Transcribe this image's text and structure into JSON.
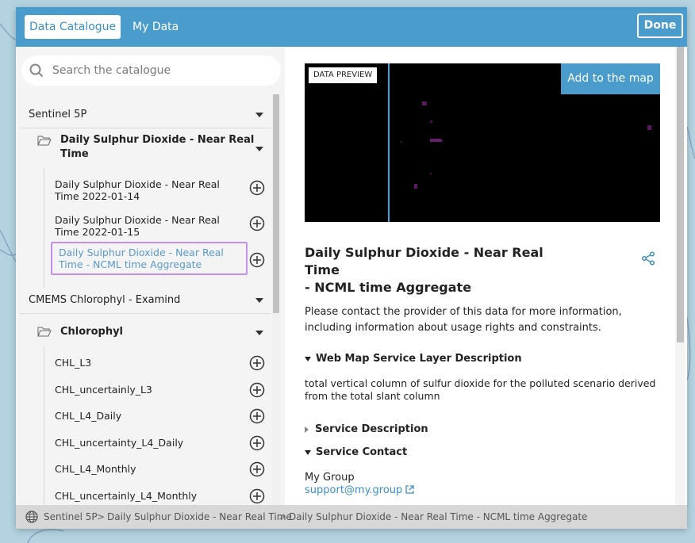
{
  "tabs": [
    {
      "label": "Data Catalogue"
    },
    {
      "label": "My Data"
    }
  ],
  "done_label": "Done",
  "search": {
    "placeholder": "Search the catalogue"
  },
  "tree": {
    "groups": [
      {
        "label": "Sentinel 5P"
      },
      {
        "label": "CMEMS Chlorophyl - Examind"
      }
    ],
    "folders": [
      {
        "label_line1": "Daily Sulphur Dioxide - Near Real",
        "label_line2": "Time"
      },
      {
        "label_line1": "Chlorophyl",
        "label_line2": ""
      }
    ],
    "items": [
      {
        "line1": "Daily Sulphur Dioxide - Near Real",
        "line2": "Time 2022-01-14"
      },
      {
        "line1": "Daily Sulphur Dioxide - Near Real",
        "line2": "Time 2022-01-15"
      },
      {
        "line1": "Daily Sulphur Dioxide - Near Real",
        "line2": "Time - NCML time Aggregate"
      },
      {
        "line1": "CHL_L3",
        "line2": ""
      },
      {
        "line1": "CHL_uncertainly_L3",
        "line2": ""
      },
      {
        "line1": "CHL_L4_Daily",
        "line2": ""
      },
      {
        "line1": "CHL_uncertainty_L4_Daily",
        "line2": ""
      },
      {
        "line1": "CHL_L4_Monthly",
        "line2": ""
      },
      {
        "line1": "CHL_uncertainly_L4_Monthly",
        "line2": ""
      }
    ]
  },
  "preview": {
    "label": "DATA PREVIEW",
    "add_button": "Add to the map"
  },
  "details": {
    "title_line1": "Daily Sulphur Dioxide - Near Real Time",
    "title_line2": "- NCML time Aggregate",
    "contact_notice_line1": "Please contact the provider of this data for more information,",
    "contact_notice_line2": "including information about usage rights and constraints.",
    "wms_heading": "Web Map Service Layer Description",
    "wms_text_line1": "total vertical column of sulfur dioxide for the polluted scenario derived",
    "wms_text_line2": "from the total slant column",
    "service_description_heading": "Service Description",
    "service_contact_heading": "Service Contact",
    "contact_name": "My Group",
    "contact_email": "support@my.group"
  },
  "breadcrumb": [
    {
      "label": "Sentinel 5P"
    },
    {
      "label": "Daily Sulphur Dioxide - Near Real Time"
    },
    {
      "label": "Daily Sulphur Dioxide - Near Real Time - NCML time Aggregate"
    }
  ],
  "breadcrumb_separator": ">",
  "colors": {
    "accent": "#4a9ccc",
    "selection_border": "#c490f0",
    "link": "#3b8fc4"
  }
}
